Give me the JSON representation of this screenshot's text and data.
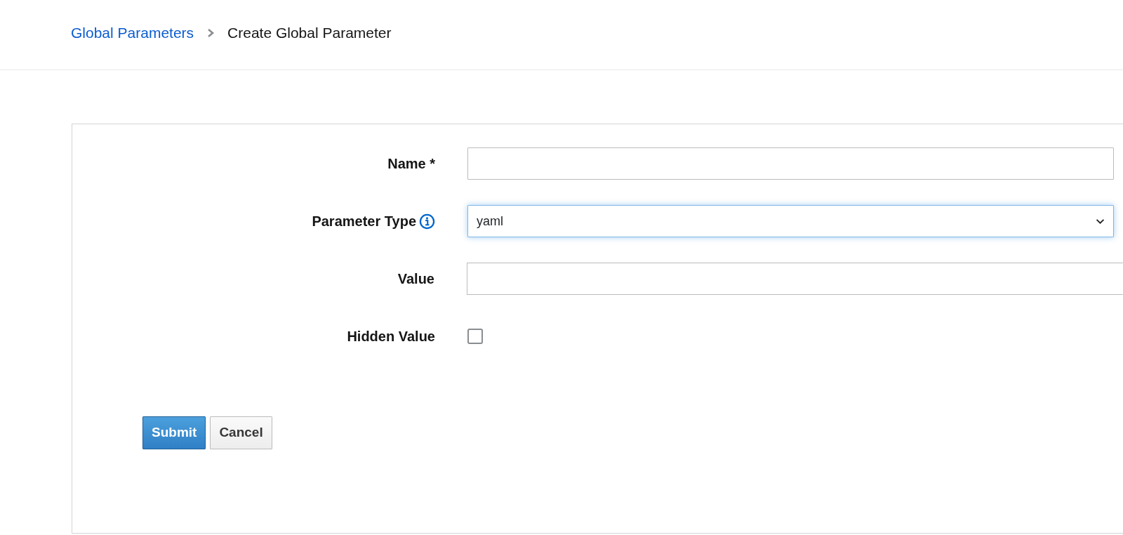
{
  "breadcrumb": [
    {
      "label": "Global Parameters",
      "kind": "link"
    },
    {
      "label": "Create Global Parameter",
      "kind": "current"
    }
  ],
  "form": {
    "fields": [
      {
        "kind": "text",
        "label": "Name *"
      },
      {
        "kind": "select",
        "label": "Parameter Type",
        "value": "yaml",
        "info": true,
        "focused": true
      },
      {
        "kind": "wide-text",
        "label": "Value"
      },
      {
        "kind": "checkbox",
        "label": "Hidden Value",
        "checked": false
      }
    ],
    "buttons": [
      {
        "label": "Submit",
        "kind": "primary"
      },
      {
        "label": "Cancel",
        "kind": "secondary"
      }
    ]
  }
}
